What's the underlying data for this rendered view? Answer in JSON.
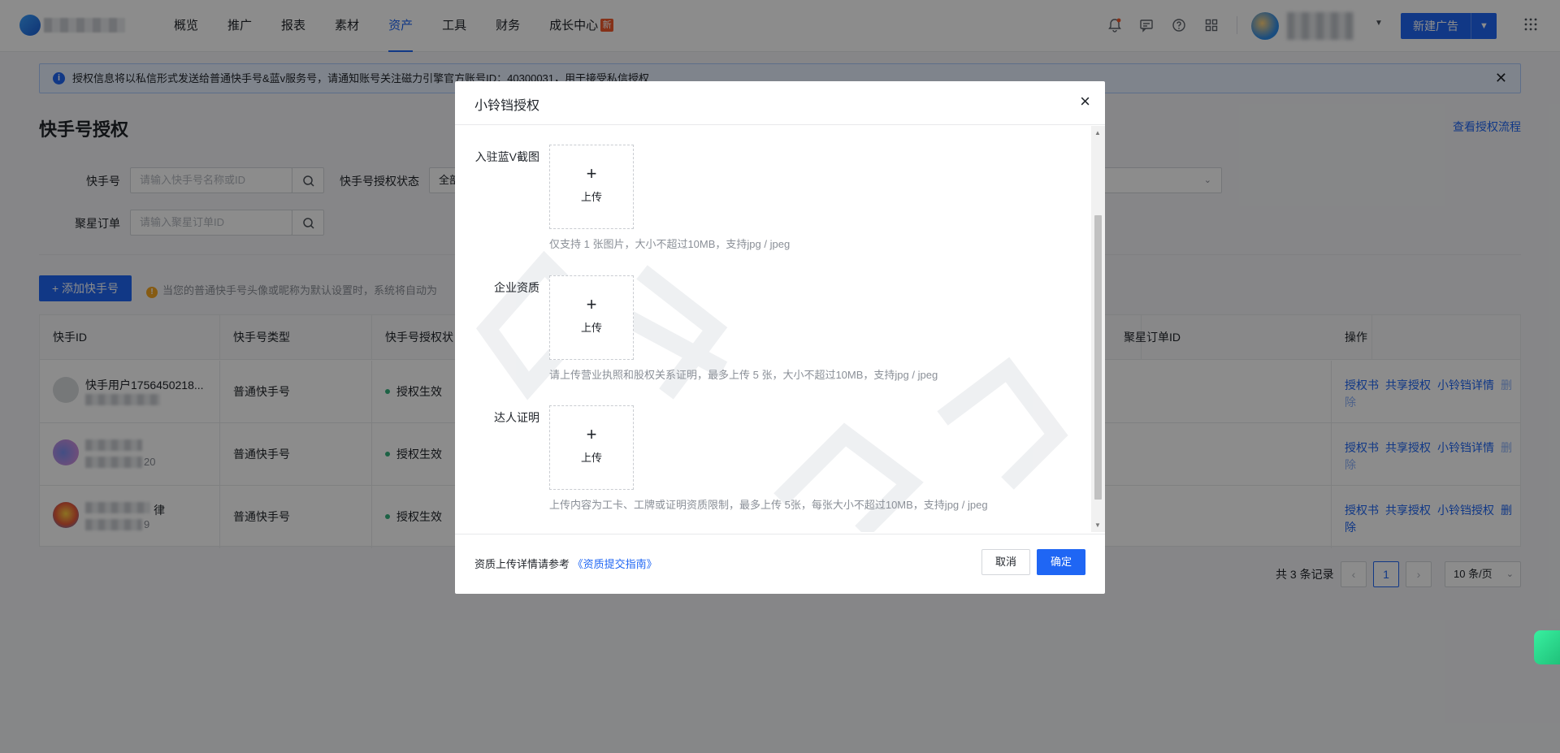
{
  "nav": {
    "menu": [
      "概览",
      "推广",
      "报表",
      "素材",
      "资产",
      "工具",
      "财务",
      "成长中心"
    ],
    "active_index": 4,
    "growth_badge": "新",
    "new_ad_label": "新建广告",
    "icons": [
      "bell-icon",
      "message-icon",
      "help-icon",
      "apps-icon",
      "grid-icon"
    ]
  },
  "notice": {
    "text": "授权信息将以私信形式发送给普通快手号&蓝v服务号，请通知账号关注磁力引擎官方账号ID：40300031，用于接受私信授权"
  },
  "page": {
    "title": "快手号授权",
    "view_flow_link": "查看授权流程"
  },
  "filters": {
    "kuaishou_label": "快手号",
    "kuaishou_placeholder": "请输入快手号名称或ID",
    "status_label": "快手号授权状态",
    "status_value": "全部",
    "order_label": "聚星订单",
    "order_placeholder": "请输入聚星订单ID"
  },
  "actions": {
    "add_label": "+ 添加快手号",
    "tip": "当您的普通快手号头像或昵称为默认设置时，系统将自动为"
  },
  "table": {
    "headers": [
      "快手ID",
      "快手号类型",
      "快手号授权状",
      "聚星订单ID",
      "操作"
    ],
    "rows": [
      {
        "name": "快手用户1756450218...",
        "type": "普通快手号",
        "status": "授权生效",
        "ops": [
          "授权书",
          "共享授权",
          "小铃铛详情",
          "删除"
        ]
      },
      {
        "name": "",
        "id_suffix": "20",
        "type": "普通快手号",
        "status": "授权生效",
        "ops": [
          "授权书",
          "共享授权",
          "小铃铛详情",
          "删除"
        ]
      },
      {
        "name": "律",
        "id_suffix": "9",
        "type": "普通快手号",
        "status": "授权生效",
        "ops": [
          "授权书",
          "共享授权",
          "小铃铛授权",
          "删除"
        ]
      }
    ]
  },
  "pagination": {
    "total_text": "共 3 条记录",
    "current_page": "1",
    "page_size": "10 条/页"
  },
  "modal": {
    "title": "小铃铛授权",
    "fields": [
      {
        "label": "入驻蓝V截图",
        "upload_text": "上传",
        "hint": "仅支持 1 张图片，大小不超过10MB，支持jpg / jpeg"
      },
      {
        "label": "企业资质",
        "upload_text": "上传",
        "hint": "请上传营业执照和股权关系证明，最多上传 5 张，大小不超过10MB，支持jpg / jpeg"
      },
      {
        "label": "达人证明",
        "upload_text": "上传",
        "hint": "上传内容为工卡、工牌或证明资质限制，最多上传 5张，每张大小不超过10MB，支持jpg / jpeg"
      }
    ],
    "footer_ref_text": "资质上传详情请参考",
    "footer_ref_link": "《资质提交指南》",
    "cancel_label": "取消",
    "ok_label": "确定"
  },
  "colors": {
    "primary": "#1f66f4",
    "success": "#36b37e",
    "warning": "#f5a623",
    "new_badge": "#f25a2c"
  }
}
